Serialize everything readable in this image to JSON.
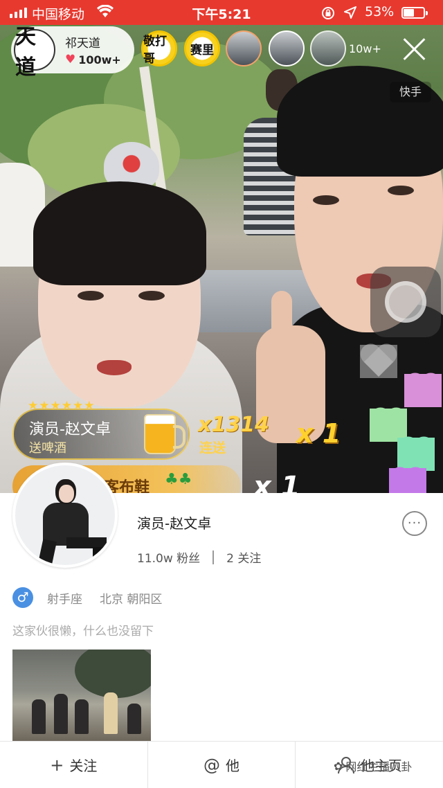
{
  "status_bar": {
    "carrier": "中国移动",
    "time": "下午5:21",
    "battery_percent": "53%",
    "battery_level": 0.53,
    "signal_icon": "signal-bars-icon",
    "wifi_icon": "wifi-icon",
    "lock_icon": "orientation-lock-icon",
    "location_icon": "location-arrow-icon"
  },
  "live": {
    "host": {
      "avatar_text": "天道",
      "name": "祁天道",
      "likes": "100w+"
    },
    "viewers": [
      {
        "type": "badge",
        "label": "敬打哥"
      },
      {
        "type": "badge",
        "label": "赛里"
      },
      {
        "type": "photo",
        "label": ""
      },
      {
        "type": "photo",
        "label": ""
      },
      {
        "type": "photo",
        "label": ""
      }
    ],
    "viewer_count": "10w+",
    "platform_watermark": "快手",
    "gift": {
      "stars": "★★★★★★",
      "sender": "演员-赵文卓",
      "action": "送啤酒",
      "combo": "x1314",
      "combo_label": "连送",
      "combo_extra": "x 1"
    },
    "gift2": {
      "text": "客布鞋",
      "combo": "x 1"
    },
    "colors": {
      "status_bar": "#e8392f",
      "gold": "#ffd24a",
      "heart": "#f0435a"
    }
  },
  "profile": {
    "name": "演员-赵文卓",
    "followers": "11.0w 粉丝",
    "following": "2 关注",
    "gender_icon": "male-icon",
    "gender_symbol": "♂",
    "zodiac": "射手座",
    "location": "北京 朝阳区",
    "bio": "这家伙很懒，什么也没留下",
    "more_icon": "ellipsis-icon",
    "more_symbol": "···"
  },
  "actions": {
    "follow_icon": "+",
    "follow": "关注",
    "mention_icon": "@",
    "mention": "他",
    "homepage": "他主页",
    "homepage_icon": "user-icon"
  },
  "overlay_watermark": "网红主播八卦"
}
